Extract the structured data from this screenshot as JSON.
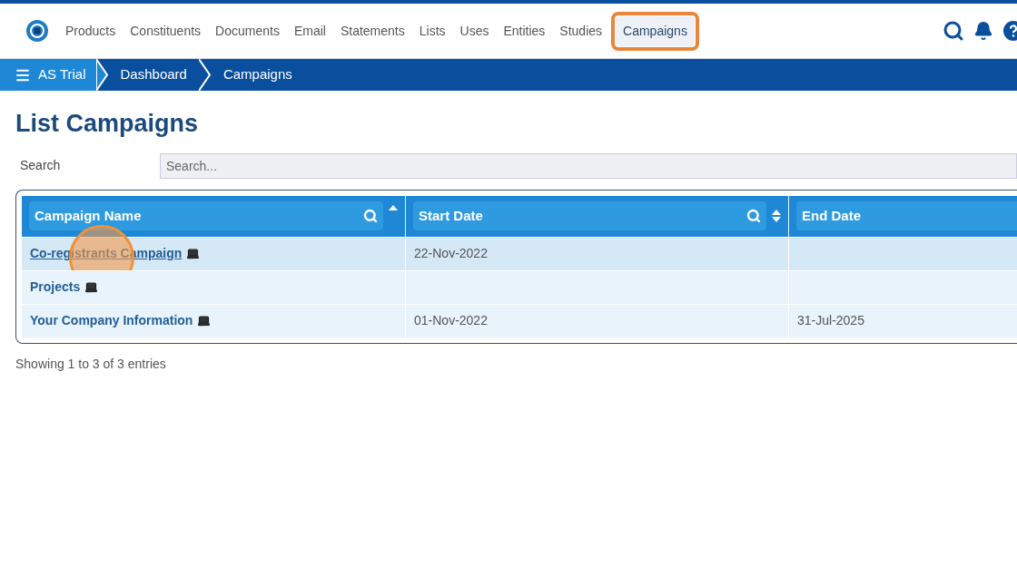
{
  "nav": {
    "items": [
      {
        "label": "Products",
        "selected": false
      },
      {
        "label": "Constituents",
        "selected": false
      },
      {
        "label": "Documents",
        "selected": false
      },
      {
        "label": "Email",
        "selected": false
      },
      {
        "label": "Statements",
        "selected": false
      },
      {
        "label": "Lists",
        "selected": false
      },
      {
        "label": "Uses",
        "selected": false
      },
      {
        "label": "Entities",
        "selected": false
      },
      {
        "label": "Studies",
        "selected": false
      },
      {
        "label": "Campaigns",
        "selected": true,
        "highlighted": true
      }
    ]
  },
  "breadcrumb": [
    "AS Trial",
    "Dashboard",
    "Campaigns"
  ],
  "page_title": "List Campaigns",
  "search": {
    "label": "Search",
    "placeholder": "Search..."
  },
  "table": {
    "columns": [
      {
        "label": "Campaign Name",
        "sortable": true,
        "sorted": true
      },
      {
        "label": "Start Date",
        "sortable": true,
        "sorted": false
      },
      {
        "label": "End Date"
      }
    ],
    "rows": [
      {
        "name": "Co-registrants Campaign",
        "start": "22-Nov-2022",
        "hovered": true,
        "clicked": true
      },
      {
        "name": "Projects",
        "hovered": false,
        "clicked": false
      },
      {
        "name": "Your Company Information",
        "start": "01-Nov-2022",
        "end": "31-Jul-2025",
        "hovered": false,
        "clicked": false
      }
    ]
  },
  "footer": "Showing 1 to 3 of 3 entries"
}
